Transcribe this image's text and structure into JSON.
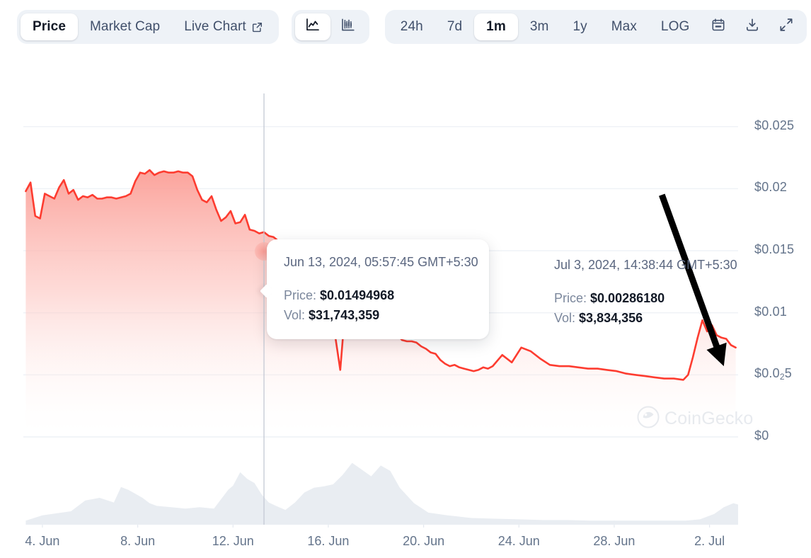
{
  "toolbar": {
    "metric_tabs": [
      {
        "label": "Price",
        "active": true
      },
      {
        "label": "Market Cap",
        "active": false
      },
      {
        "label": "Live Chart",
        "active": false,
        "icon": "external-link-icon"
      }
    ],
    "chart_type_tabs": [
      {
        "icon": "line-chart-icon",
        "label": "",
        "active": true
      },
      {
        "icon": "candlestick-chart-icon",
        "label": "",
        "active": false
      }
    ],
    "range_tabs": [
      {
        "label": "24h",
        "active": false
      },
      {
        "label": "7d",
        "active": false
      },
      {
        "label": "1m",
        "active": true
      },
      {
        "label": "3m",
        "active": false
      },
      {
        "label": "1y",
        "active": false
      },
      {
        "label": "Max",
        "active": false
      },
      {
        "label": "LOG",
        "active": false
      }
    ],
    "action_icons": [
      {
        "icon": "calendar-icon",
        "label": ""
      },
      {
        "icon": "download-icon",
        "label": ""
      },
      {
        "icon": "expand-icon",
        "label": ""
      }
    ]
  },
  "tooltip_primary": {
    "date": "Jun 13, 2024, 05:57:45 GMT+5:30",
    "price_label": "Price:",
    "price_value": "$0.01494968",
    "vol_label": "Vol:",
    "vol_value": "$31,743,359"
  },
  "tooltip_secondary": {
    "date": "Jul 3, 2024, 14:38:44 GMT+5:30",
    "price_label": "Price:",
    "price_value": "$0.00286180",
    "vol_label": "Vol:",
    "vol_value": "$3,834,356"
  },
  "watermark": {
    "text": "CoinGecko",
    "icon": "coingecko-logo-icon"
  },
  "colors": {
    "line": "#fd3c30",
    "area_top": "#fcaba5",
    "area_bottom": "#ffffff",
    "grid": "#eef1f6",
    "axis_text": "#64748b",
    "toolbar_bg": "#eef2f7",
    "active_text": "#121926",
    "inactive_text": "#41506b",
    "volume_bars": "#e9edf2",
    "crosshair": "#c3c9d4",
    "arrow": "#000000"
  },
  "chart_data": {
    "type": "area",
    "title": "",
    "xlabel": "",
    "ylabel": "",
    "legend_position": "none",
    "grid": true,
    "y_ticks": [
      "$0.025",
      "$0.02",
      "$0.015",
      "$0.01",
      "$0.0₂5",
      "$0"
    ],
    "y_tick_values": [
      0.025,
      0.02,
      0.015,
      0.01,
      0.005,
      0
    ],
    "ylim": [
      0,
      0.0275
    ],
    "x_ticks": [
      "4. Jun",
      "8. Jun",
      "12. Jun",
      "16. Jun",
      "20. Jun",
      "24. Jun",
      "28. Jun",
      "2. Jul"
    ],
    "x_tick_values": [
      4,
      8,
      12,
      16,
      20,
      24,
      28,
      32
    ],
    "xlim": [
      3.2,
      33.2
    ],
    "series": [
      {
        "name": "Price",
        "units": "USD",
        "x": [
          3.3,
          3.5,
          3.7,
          3.9,
          4.1,
          4.3,
          4.5,
          4.7,
          4.9,
          5.1,
          5.3,
          5.5,
          5.7,
          5.9,
          6.1,
          6.3,
          6.5,
          6.7,
          6.9,
          7.1,
          7.3,
          7.5,
          7.7,
          7.9,
          8.1,
          8.3,
          8.5,
          8.7,
          8.9,
          9.1,
          9.3,
          9.5,
          9.7,
          9.9,
          10.1,
          10.3,
          10.5,
          10.7,
          10.9,
          11.1,
          11.3,
          11.5,
          11.7,
          11.9,
          12.1,
          12.3,
          12.5,
          12.7,
          12.9,
          13.1,
          13.3,
          13.5,
          13.7,
          13.9,
          14.1,
          14.2,
          14.3,
          14.4,
          14.5,
          14.7,
          14.9,
          15.1,
          15.3,
          15.5,
          15.7,
          15.9,
          16.1,
          16.3,
          16.5,
          16.7,
          16.9,
          17.1,
          17.3,
          17.5,
          17.7,
          17.9,
          18.1,
          18.3,
          18.5,
          18.7,
          18.9,
          19.1,
          19.3,
          19.5,
          19.7,
          19.9,
          20.1,
          20.3,
          20.5,
          20.7,
          20.9,
          21.1,
          21.3,
          21.5,
          21.7,
          21.9,
          22.1,
          22.3,
          22.5,
          22.7,
          22.9,
          23.3,
          23.7,
          24.1,
          24.5,
          24.9,
          25.3,
          25.7,
          26.1,
          26.5,
          26.9,
          27.3,
          27.7,
          28.1,
          28.5,
          28.9,
          29.3,
          29.7,
          30.1,
          30.5,
          30.9,
          31.1,
          31.3,
          31.5,
          31.7,
          31.9,
          32.1,
          32.3,
          32.5,
          32.7,
          32.9,
          33.1
        ],
        "y": [
          0.0198,
          0.0205,
          0.0178,
          0.0176,
          0.0196,
          0.0194,
          0.0192,
          0.0201,
          0.0207,
          0.0196,
          0.0199,
          0.0191,
          0.0194,
          0.0193,
          0.0195,
          0.0192,
          0.0192,
          0.0193,
          0.0193,
          0.0192,
          0.0193,
          0.0194,
          0.0196,
          0.0206,
          0.0213,
          0.0212,
          0.0215,
          0.0211,
          0.0213,
          0.0214,
          0.0213,
          0.0213,
          0.0214,
          0.0213,
          0.0213,
          0.021,
          0.0199,
          0.0191,
          0.0189,
          0.0194,
          0.0183,
          0.0174,
          0.0177,
          0.0182,
          0.0172,
          0.0173,
          0.0179,
          0.0167,
          0.0166,
          0.0164,
          0.0165,
          0.0162,
          0.0161,
          0.0158,
          0.015,
          0.0143,
          0.015,
          0.0147,
          0.0151,
          0.0149,
          0.0149,
          0.015,
          0.0152,
          0.0148,
          0.0147,
          0.0148,
          0.009,
          0.008,
          0.0054,
          0.0101,
          0.0097,
          0.0089,
          0.0085,
          0.0088,
          0.0091,
          0.0083,
          0.0085,
          0.0084,
          0.0086,
          0.0083,
          0.0082,
          0.0078,
          0.0077,
          0.0077,
          0.0076,
          0.0073,
          0.0071,
          0.0068,
          0.0067,
          0.0062,
          0.0059,
          0.0057,
          0.0058,
          0.0056,
          0.0055,
          0.0054,
          0.0053,
          0.0054,
          0.0056,
          0.0055,
          0.0057,
          0.0066,
          0.006,
          0.0072,
          0.0069,
          0.0063,
          0.0058,
          0.0057,
          0.0057,
          0.0056,
          0.0055,
          0.0055,
          0.0054,
          0.0053,
          0.0051,
          0.005,
          0.0049,
          0.0048,
          0.0047,
          0.0047,
          0.0046,
          0.005,
          0.0064,
          0.008,
          0.0094,
          0.0085,
          0.009,
          0.0082,
          0.008,
          0.0079,
          0.0074,
          0.0072
        ]
      }
    ],
    "volume_series": {
      "name": "Volume",
      "x": [
        3.3,
        4.0,
        4.6,
        5.2,
        5.8,
        6.4,
        7.0,
        7.3,
        7.6,
        7.9,
        8.2,
        8.5,
        8.8,
        9.4,
        10.0,
        10.6,
        11.2,
        11.8,
        12.0,
        12.3,
        12.6,
        12.9,
        13.2,
        13.5,
        13.8,
        14.2,
        14.6,
        15.0,
        15.4,
        15.8,
        16.2,
        16.6,
        17.0,
        17.4,
        17.8,
        18.2,
        18.6,
        19.0,
        19.6,
        20.2,
        21.0,
        22.0,
        23.0,
        24.0,
        25.0,
        26.0,
        27.0,
        28.0,
        29.0,
        30.0,
        31.0,
        31.6,
        32.2,
        32.6,
        33.0,
        33.2
      ],
      "y": [
        0.06,
        0.14,
        0.17,
        0.2,
        0.36,
        0.4,
        0.33,
        0.56,
        0.52,
        0.46,
        0.4,
        0.32,
        0.28,
        0.26,
        0.24,
        0.26,
        0.24,
        0.52,
        0.58,
        0.78,
        0.68,
        0.62,
        0.45,
        0.33,
        0.28,
        0.22,
        0.33,
        0.48,
        0.55,
        0.57,
        0.6,
        0.74,
        0.92,
        0.82,
        0.72,
        0.88,
        0.8,
        0.55,
        0.32,
        0.18,
        0.14,
        0.1,
        0.09,
        0.08,
        0.07,
        0.07,
        0.06,
        0.06,
        0.06,
        0.06,
        0.06,
        0.08,
        0.16,
        0.26,
        0.32,
        0.3
      ]
    },
    "crosshair": {
      "x_value": 13.3,
      "price": 0.01494968,
      "label": "Jun 13, 2024, 05:57:45 GMT+5:30"
    },
    "annotation_arrow": {
      "from_x": 30.0,
      "from_y": 0.0195,
      "to_x": 32.6,
      "to_y": 0.0057,
      "color": "#000000"
    }
  }
}
